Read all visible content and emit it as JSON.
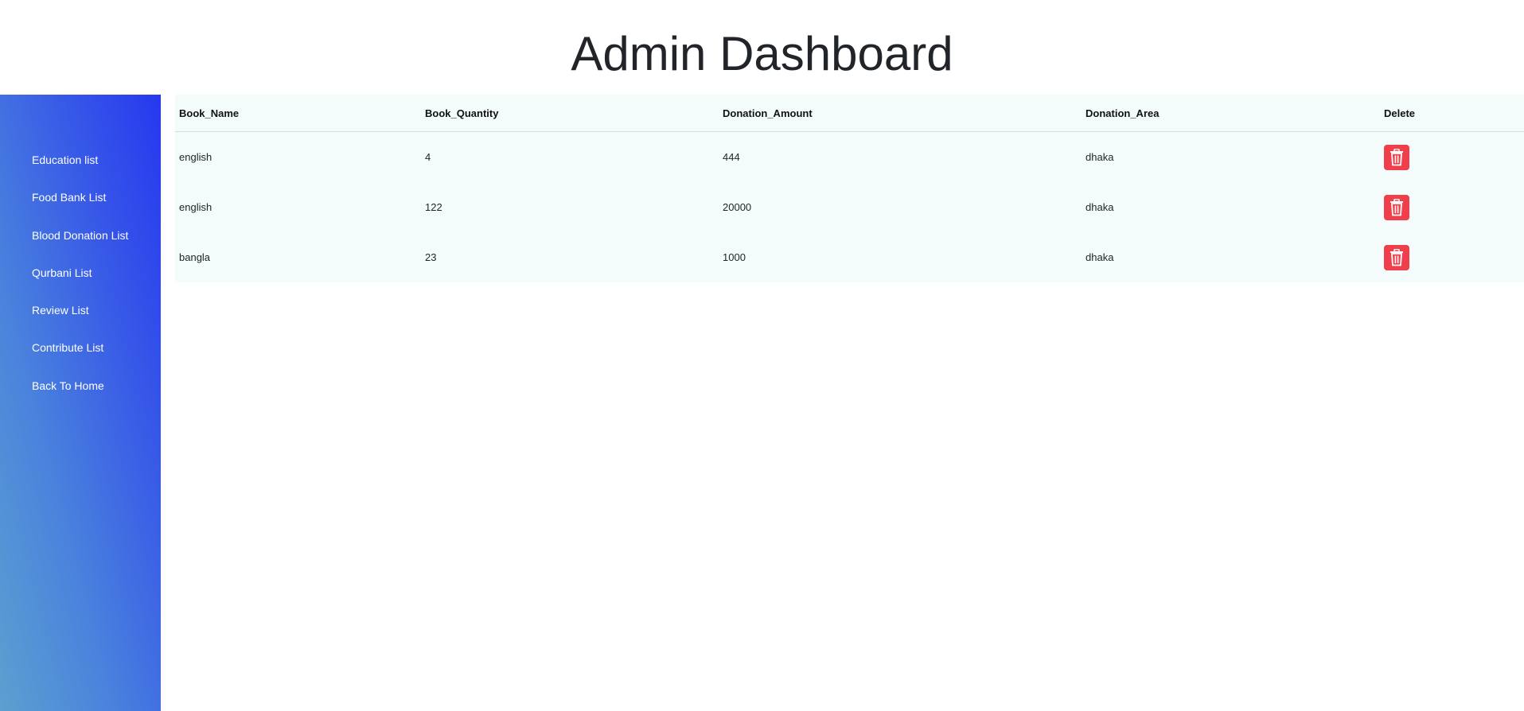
{
  "header": {
    "title": "Admin Dashboard"
  },
  "sidebar": {
    "items": [
      {
        "label": "Education list"
      },
      {
        "label": "Food Bank List"
      },
      {
        "label": "Blood Donation List"
      },
      {
        "label": "Qurbani List"
      },
      {
        "label": "Review List"
      },
      {
        "label": "Contribute List"
      },
      {
        "label": "Back To Home"
      }
    ]
  },
  "table": {
    "columns": [
      "Book_Name",
      "Book_Quantity",
      "Donation_Amount",
      "Donation_Area",
      "Delete"
    ],
    "rows": [
      {
        "book_name": "english",
        "book_quantity": "4",
        "donation_amount": "444",
        "donation_area": "dhaka"
      },
      {
        "book_name": "english",
        "book_quantity": "122",
        "donation_amount": "20000",
        "donation_area": "dhaka"
      },
      {
        "book_name": "bangla",
        "book_quantity": "23",
        "donation_amount": "1000",
        "donation_area": "dhaka"
      }
    ],
    "delete_icon": "trash-icon"
  },
  "colors": {
    "sidebar_gradient_start": "#5ba0d0",
    "sidebar_gradient_end": "#2638ef",
    "table_background": "#f3fcfb",
    "delete_button": "#f03e4b"
  }
}
